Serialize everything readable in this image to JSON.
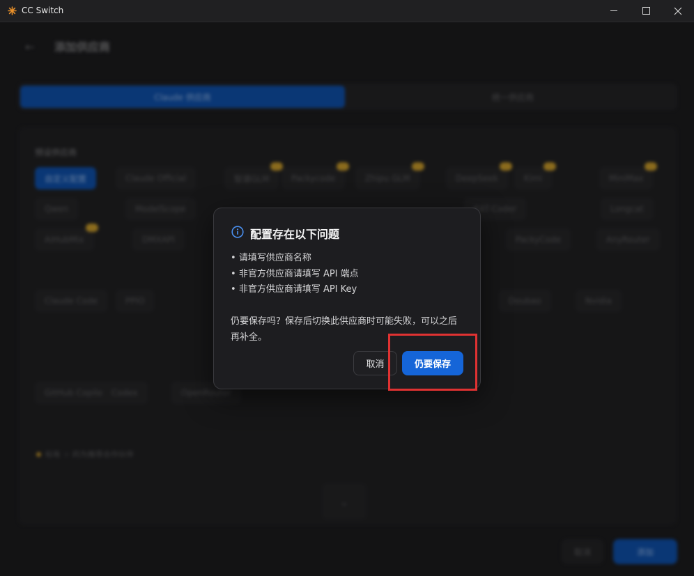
{
  "window": {
    "title": "CC Switch",
    "controls": {
      "minimize": "minimize-icon",
      "maximize": "maximize-icon",
      "close": "close-icon"
    }
  },
  "background": {
    "page_title": "添加供应商",
    "tabs": [
      "Claude 供应商",
      "统一供应商"
    ],
    "section_label": "预设供应商",
    "presets": [
      "自定义配置",
      "Claude Official",
      "智谱GLM",
      "Packycode",
      "Zhipu GLM",
      "DeepSeek",
      "Kimi",
      "MiniMax",
      "Qwen",
      "ModelScope",
      "KAT-Coder",
      "Longcat",
      "AiHubMix",
      "DMXAPI",
      "PackyCode",
      "AnyRouter",
      "Claude Code",
      "PPIO",
      "Doubao",
      "Nvidia",
      "GitHub Copilot",
      "Codex",
      "OpenRouter"
    ],
    "hint": "标有 ☆ 的为推荐合作伙伴",
    "footer_cancel": "取消",
    "footer_add": "添加"
  },
  "dialog": {
    "icon": "info-icon",
    "title": "配置存在以下问题",
    "issues": [
      "请填写供应商名称",
      "非官方供应商请填写 API 端点",
      "非官方供应商请填写 API Key"
    ],
    "warning": "仍要保存吗？保存后切换此供应商时可能失败，可以之后再补全。",
    "cancel_label": "取消",
    "save_label": "仍要保存"
  },
  "colors": {
    "accent": "#1565d8",
    "dialog_bg": "#1d1d20",
    "info_icon": "#4a90f0",
    "highlight": "#e03232"
  }
}
